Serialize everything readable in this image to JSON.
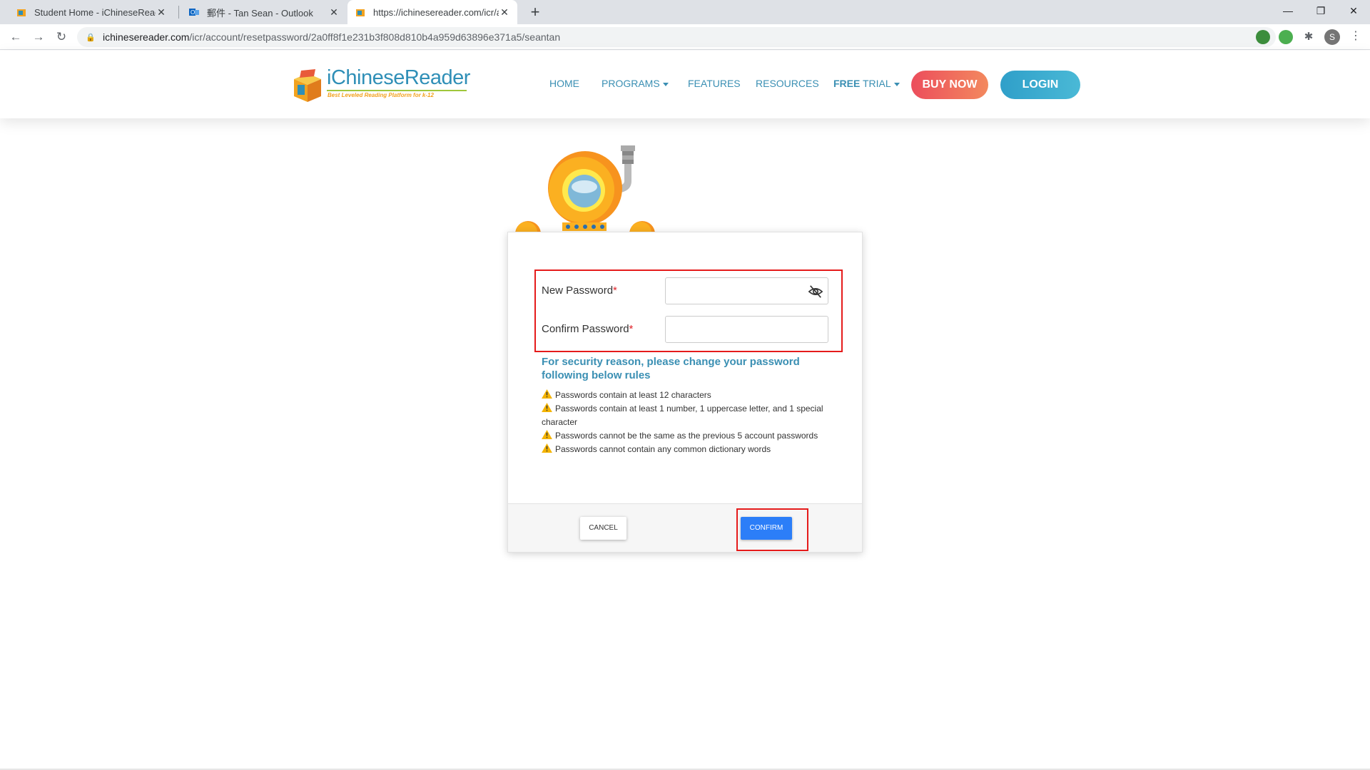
{
  "browser": {
    "tabs": [
      {
        "title": "Student Home - iChineseReader",
        "favicon": "icr-favicon-icon"
      },
      {
        "title": "郵件 - Tan Sean - Outlook",
        "favicon": "outlook-icon"
      },
      {
        "title": "https://ichinesereader.com/icr/ac",
        "favicon": "icr-favicon-icon"
      }
    ],
    "address": {
      "host": "ichinesereader.com",
      "path": "/icr/account/resetpassword/2a0ff8f1e231b3f808d810b4a959d63896e371a5/seantan"
    },
    "profile_initial": "S"
  },
  "site": {
    "logo_title": "iChineseReader",
    "logo_tagline": "Best Leveled Reading Platform for k-12",
    "nav": {
      "home": "HOME",
      "programs": "PROGRAMS",
      "features": "FEATURES",
      "resources": "RESOURCES",
      "free_trial_bold": "FREE",
      "free_trial_rest": " TRIAL"
    },
    "buy_now": "BUY NOW",
    "login": "LOGIN"
  },
  "form": {
    "new_password_label": "New Password",
    "confirm_password_label": "Confirm Password",
    "required_mark": "*",
    "new_password_value": "",
    "confirm_password_value": "",
    "security_title": "For security reason, please change your password following below rules",
    "rules": [
      "Passwords contain at least 12 characters",
      "Passwords contain at least 1 number, 1 uppercase letter, and 1 special character",
      "Passwords cannot be the same as the previous 5 account passwords",
      "Passwords cannot contain any common dictionary words"
    ],
    "cancel": "CANCEL",
    "confirm": "CONFIRM"
  },
  "colors": {
    "accent_blue": "#3a8fb3",
    "highlight_red": "#e51b1b",
    "confirm_blue": "#2c7ef8",
    "warning_yellow": "#f5b400"
  }
}
